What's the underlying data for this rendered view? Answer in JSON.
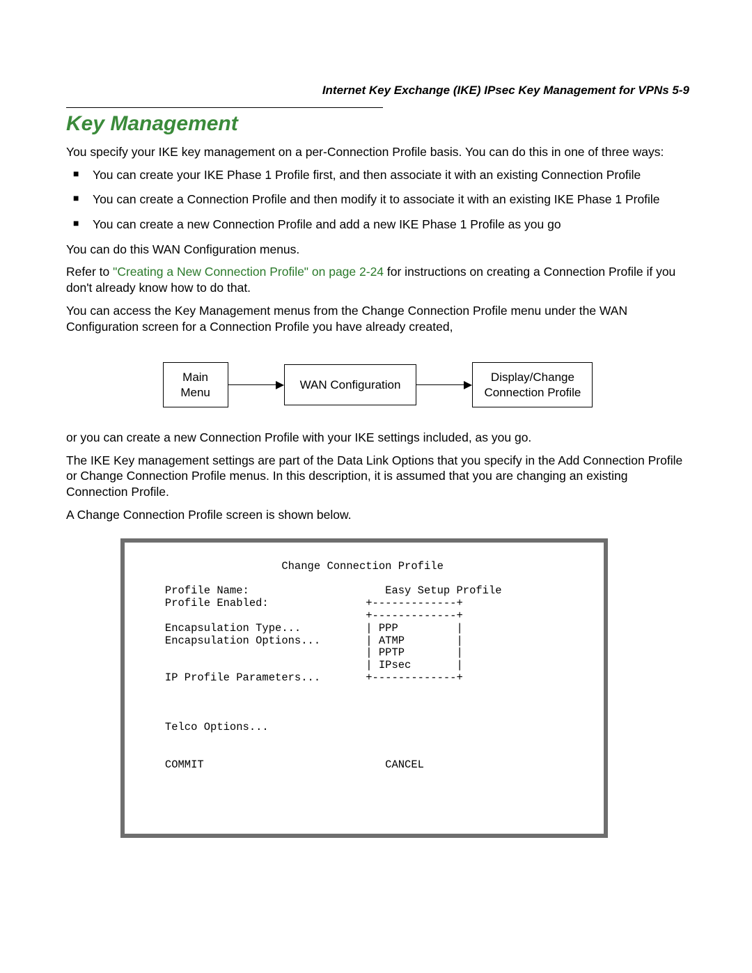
{
  "header": {
    "running_head": "Internet Key Exchange (IKE) IPsec Key Management for VPNs   5-9"
  },
  "title": "Key Management",
  "p1": "You specify your IKE key management on a per-Connection Profile basis. You can do this in one of three ways:",
  "bullets": [
    "You can create your IKE Phase 1 Profile first, and then associate it with an existing Connection Profile",
    "You can create a Connection Profile and then modify it to associate it with an existing IKE Phase 1 Profile",
    "You can create a new Connection Profile and add a new IKE Phase 1 Profile as you go"
  ],
  "p2": "You can do this WAN Configuration menus.",
  "p3_pre": "Refer to ",
  "p3_link": "\"Creating a New Connection Profile\" on page 2-24",
  "p3_post": " for instructions on creating a Connection Profile if you don't already know how to do that.",
  "p4": "You can access the Key Management menus from the Change Connection Profile menu under the WAN Configuration screen for a Connection Profile you have already created,",
  "flow": {
    "box1_l1": "Main",
    "box1_l2": "Menu",
    "box2": "WAN Configuration",
    "box3_l1": "Display/Change",
    "box3_l2": "Connection Profile"
  },
  "p5": "or you can create a new Connection Profile with your IKE settings included, as you go.",
  "p6": "The IKE Key management settings are part of the Data Link Options that you specify in the Add Connection Profile or Change Connection Profile menus. In this description, it is assumed that you are changing an existing Connection Profile.",
  "p7": "A Change Connection Profile screen is shown below.",
  "terminal": "                     Change Connection Profile\n\n   Profile Name:                     Easy Setup Profile\n   Profile Enabled:               +-------------+\n                                  +-------------+\n   Encapsulation Type...          | PPP         |\n   Encapsulation Options...       | ATMP        |\n                                  | PPTP        |\n                                  | IPsec       |\n   IP Profile Parameters...       +-------------+\n\n\n\n   Telco Options...\n\n\n   COMMIT                            CANCEL"
}
